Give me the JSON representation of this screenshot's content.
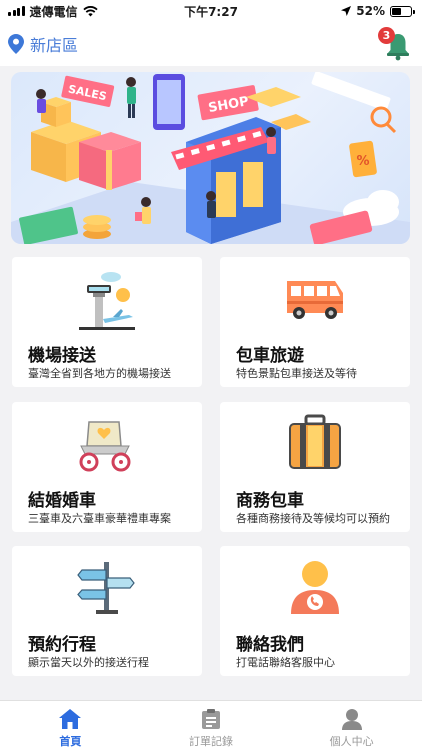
{
  "status_bar": {
    "carrier": "遠傳電信",
    "time": "下午7:27",
    "battery": "52%",
    "battery_level": 0.52
  },
  "header": {
    "location": "新店區",
    "notification_count": "3"
  },
  "banner": {
    "sign_sales": "SALES",
    "sign_shop": "SHOP"
  },
  "services": [
    {
      "title": "機場接送",
      "desc": "臺灣全省到各地方的機場接送",
      "icon": "airport-tower-icon"
    },
    {
      "title": "包車旅遊",
      "desc": "特色景點包車接送及等待",
      "icon": "tour-bus-icon"
    },
    {
      "title": "結婚婚車",
      "desc": "三臺車及六臺車豪華禮車專案",
      "icon": "wedding-carriage-icon"
    },
    {
      "title": "商務包車",
      "desc": "各種商務接待及等候均可以預約",
      "icon": "suitcase-icon"
    },
    {
      "title": "預約行程",
      "desc": "顯示當天以外的接送行程",
      "icon": "signpost-icon"
    },
    {
      "title": "聯絡我們",
      "desc": "打電話聯絡客服中心",
      "icon": "customer-service-icon"
    }
  ],
  "tabbar": {
    "items": [
      {
        "label": "首頁",
        "icon": "home-icon",
        "active": true
      },
      {
        "label": "訂單記錄",
        "icon": "clipboard-icon",
        "active": false
      },
      {
        "label": "個人中心",
        "icon": "user-icon",
        "active": false
      }
    ],
    "active_color": "#2d6cdf"
  }
}
